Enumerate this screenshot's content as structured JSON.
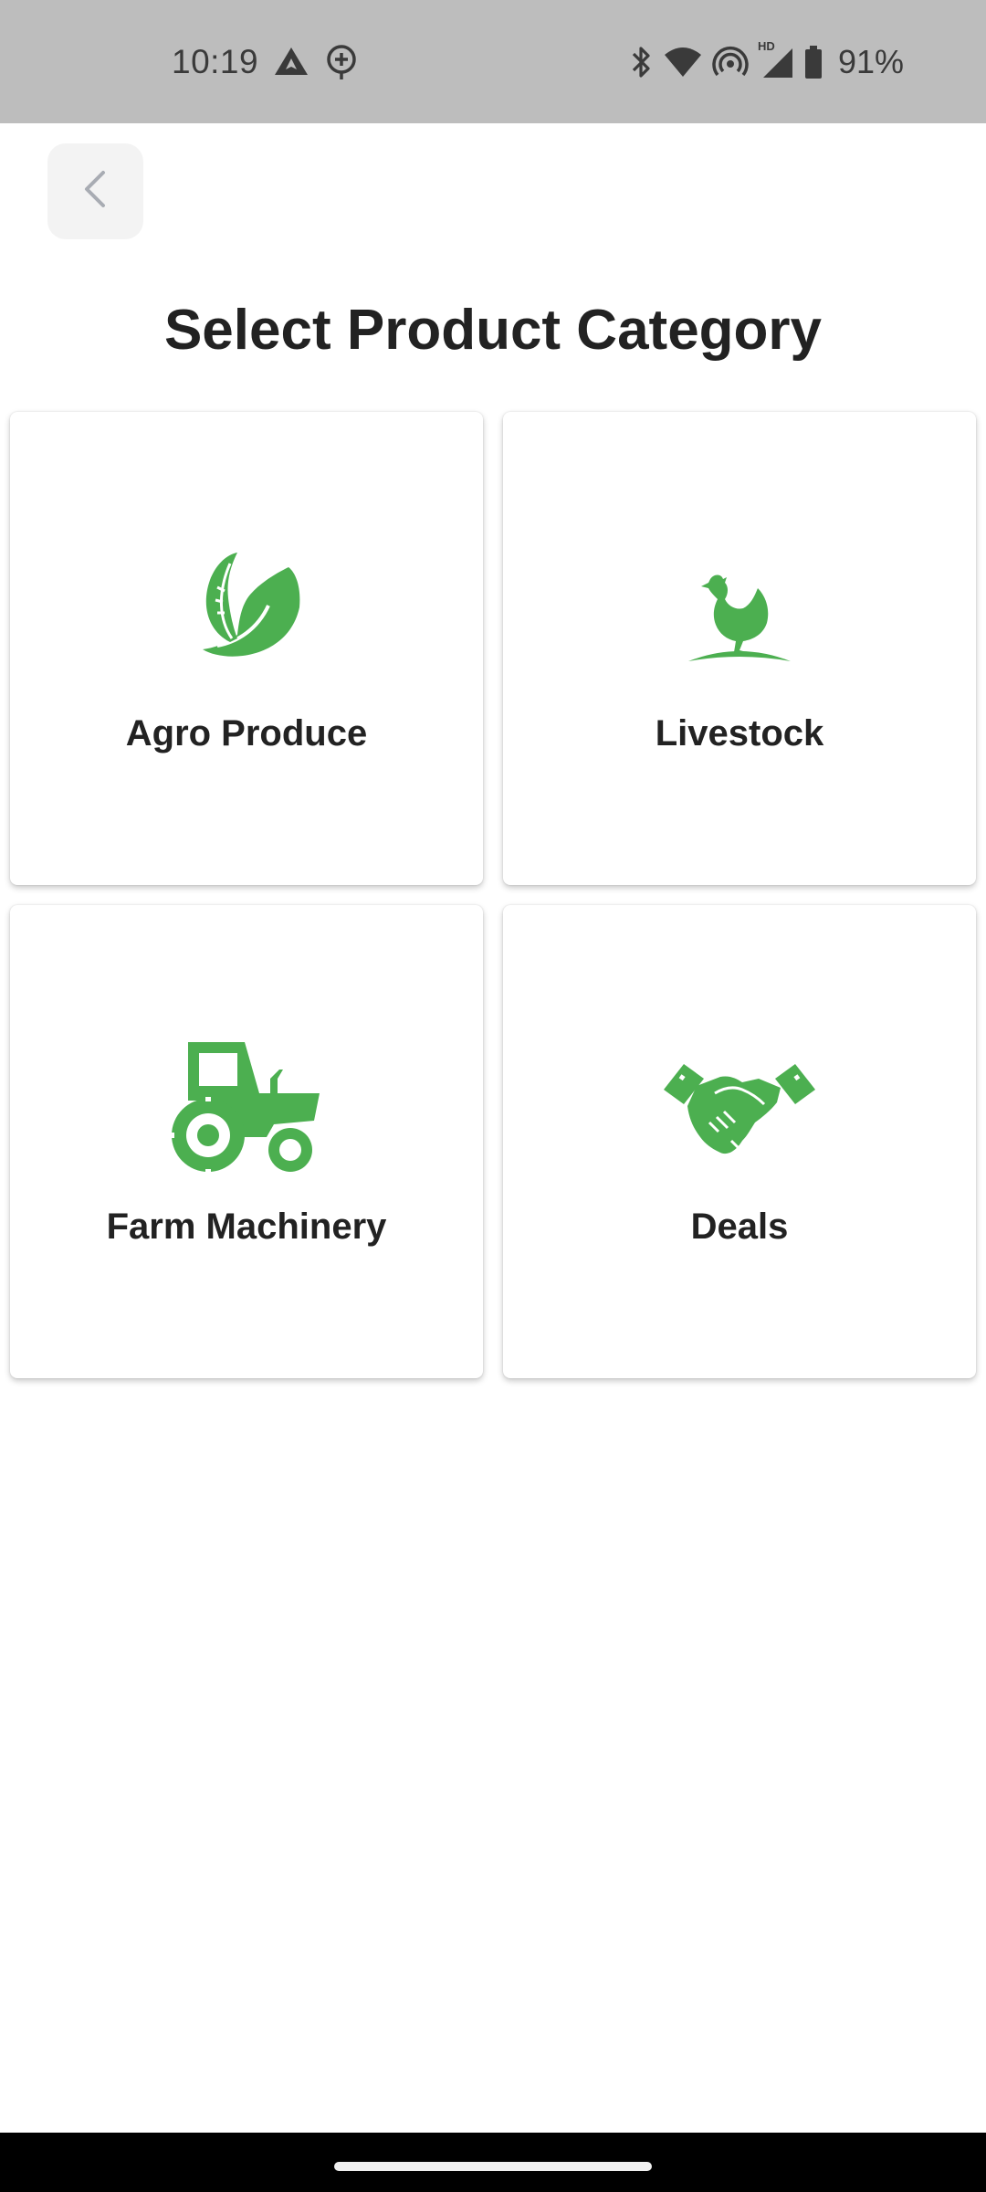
{
  "status_bar": {
    "time": "10:19",
    "battery": "91%",
    "hd_label": "HD",
    "left_icons": [
      "navigation-icon",
      "add-location-icon"
    ],
    "right_icons": [
      "bluetooth-icon",
      "wifi-icon",
      "hotspot-icon",
      "signal-icon",
      "battery-icon"
    ]
  },
  "header": {
    "back_icon": "chevron-left-icon",
    "title": "Select Product Category"
  },
  "categories": [
    {
      "label": "Agro Produce",
      "icon": "leaf-icon"
    },
    {
      "label": "Livestock",
      "icon": "hen-icon"
    },
    {
      "label": "Farm Machinery",
      "icon": "tractor-icon"
    },
    {
      "label": "Deals",
      "icon": "handshake-icon"
    }
  ],
  "colors": {
    "accent": "#4CAF50",
    "status_bar_bg": "#BDBDBD",
    "text": "#222222"
  }
}
